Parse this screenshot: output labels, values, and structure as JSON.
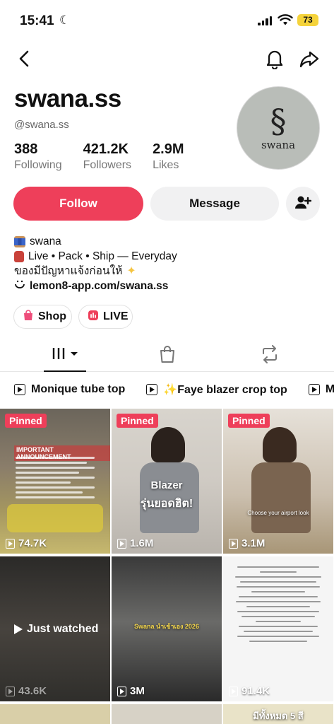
{
  "status_bar": {
    "time": "15:41",
    "battery": "73"
  },
  "profile": {
    "username": "swana.ss",
    "handle": "@swana.ss",
    "avatar_text": "swana",
    "avatar_monogram": "S"
  },
  "stats": [
    {
      "value": "388",
      "label": "Following"
    },
    {
      "value": "421.2K",
      "label": "Followers"
    },
    {
      "value": "2.9M",
      "label": "Likes"
    }
  ],
  "actions": {
    "follow": "Follow",
    "message": "Message"
  },
  "bio": {
    "line1": "swana",
    "line2": "Live • Pack • Ship — Everyday",
    "line3": "ของมีปัญหาแจ้งก่อนให้",
    "link": "lemon8-app.com/swana.ss"
  },
  "pills": {
    "shop": "Shop",
    "live": "LIVE"
  },
  "playlists": [
    "Monique tube top",
    "✨Faye blazer crop top",
    "M"
  ],
  "videos": [
    {
      "pinned": "Pinned",
      "views": "74.7K",
      "caption": "IMPORTANT ANNOUNCEMENT"
    },
    {
      "pinned": "Pinned",
      "views": "1.6M",
      "caption": "Blazer",
      "caption2": "รุ่นยอดฮิต!"
    },
    {
      "pinned": "Pinned",
      "views": "3.1M",
      "caption": "Choose your airport look"
    },
    {
      "views": "43.6K",
      "overlay": "Just watched"
    },
    {
      "views": "3M",
      "caption": "Swana นำเข้าเอง 2026"
    },
    {
      "views": "91.4K"
    },
    {
      "caption": "มีทั้งหมด 5 สี"
    }
  ],
  "colors": {
    "accent": "#ee3f5a",
    "secondary_button": "#f1f1f2",
    "battery": "#f5d33b"
  }
}
